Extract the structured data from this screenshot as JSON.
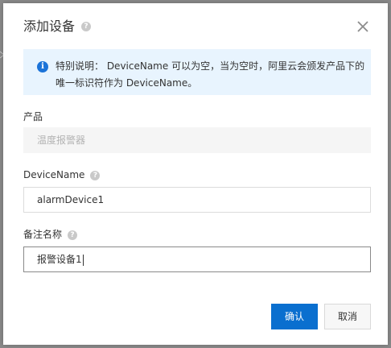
{
  "modal": {
    "title": "添加设备",
    "notice": "特别说明： DeviceName 可以为空，当为空时，阿里云会颁发产品下的唯一标识符作为 DeviceName。",
    "help_glyph": "?",
    "info_glyph": "i"
  },
  "form": {
    "product_label": "产品",
    "product_value": "温度报警器",
    "device_name_label": "DeviceName",
    "device_name_value": "alarmDevice1",
    "remark_label": "备注名称",
    "remark_value": "报警设备1"
  },
  "buttons": {
    "confirm": "确认",
    "cancel": "取消"
  },
  "colors": {
    "primary": "#0a6fcf",
    "notice_bg": "#e8f4fe",
    "info_icon": "#1b73d8"
  },
  "icons": {
    "close": "close-icon",
    "info": "info-icon",
    "help": "question-icon"
  }
}
